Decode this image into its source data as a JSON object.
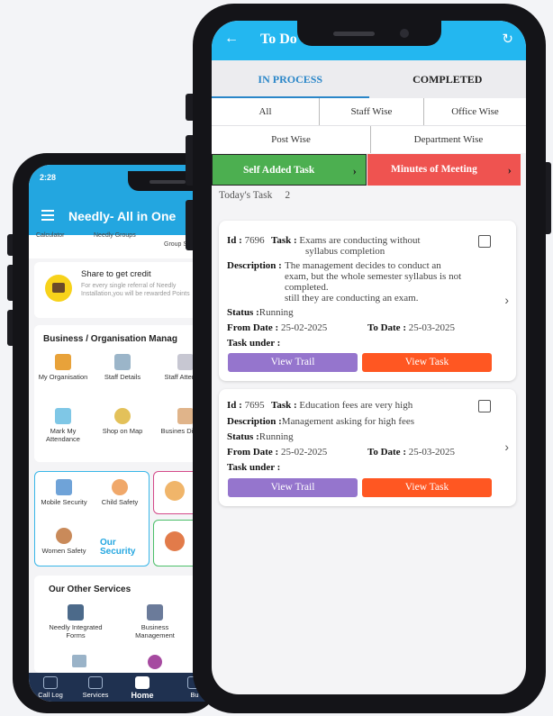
{
  "back_phone": {
    "status_time": "2:28",
    "app_title": "Needly- All in One",
    "cut_row": {
      "left": "Calculator",
      "middle": "Needly Groups",
      "right": "Group Se"
    },
    "share_card": {
      "title": "Share to get credit",
      "desc": "For every single referral of Needly Installation,you will be rewarded Points"
    },
    "business": {
      "title": "Business / Organisation Manag",
      "tiles": [
        "My Organisation",
        "Staff Details",
        "Staff Attendan",
        "Mark My Attendance",
        "Shop on Map",
        "Busines Director"
      ]
    },
    "security": {
      "tiles": [
        "Mobile Security",
        "Child Safety",
        "Women Safety"
      ],
      "badge": "Our Security"
    },
    "other": {
      "title": "Our Other Services",
      "tiles": [
        "Needly Integrated Forms",
        "Business Management"
      ]
    },
    "nav": [
      "Call Log",
      "Services",
      "Home",
      "Bu"
    ]
  },
  "front_phone": {
    "header_title": "To Do Task / Event List",
    "tabs": [
      {
        "label": "IN PROCESS",
        "active": true
      },
      {
        "label": "COMPLETED",
        "active": false
      }
    ],
    "filters_row1": [
      "All",
      "Staff Wise",
      "Office Wise"
    ],
    "filters_row2": [
      "Post Wise",
      "Department Wise"
    ],
    "actions": [
      {
        "label": "Self Added Task",
        "color": "#4caf50"
      },
      {
        "label": "Minutes of Meeting",
        "color": "#ef5350"
      }
    ],
    "today_label": "Today's Task",
    "today_count": "2",
    "labels": {
      "id": "Id :",
      "task": "Task :",
      "description": "Description :",
      "status": "Status :",
      "from": "From Date :",
      "to": "To Date :",
      "task_under": "Task under :",
      "view_trail": "View Trail",
      "view_task": "View Task"
    },
    "tasks": [
      {
        "id": "7696",
        "task_line1": "Exams are conducting without",
        "task_line2": "syllabus completion",
        "desc_line1": "The management decides to conduct an",
        "desc_line2": "exam, but the whole semester syllabus is not",
        "desc_line3": "completed.",
        "desc_line4": "still they are conducting an exam.",
        "status": "Running",
        "from_date": "25-02-2025",
        "to_date": "25-03-2025"
      },
      {
        "id": "7695",
        "task_line1": "Education fees are very high",
        "desc_line1": "Management asking for high fees",
        "status": "Running",
        "from_date": "25-02-2025",
        "to_date": "25-03-2025"
      }
    ],
    "colors": {
      "view_trail": "#9575cd",
      "view_task": "#ff5722",
      "header": "#23b7f0"
    }
  }
}
